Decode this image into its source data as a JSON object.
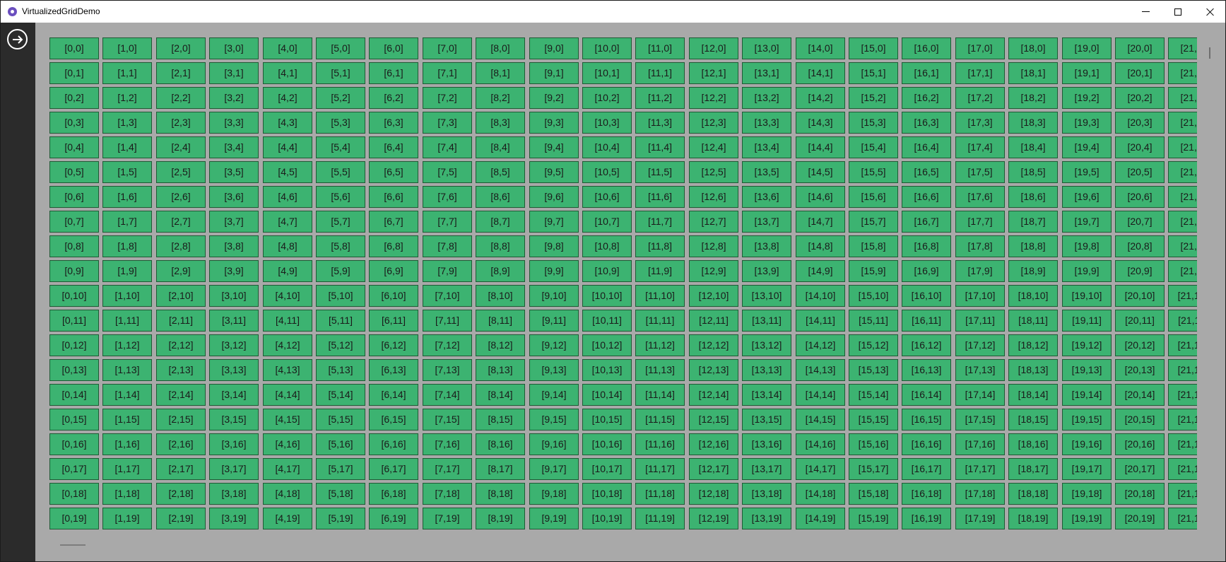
{
  "window": {
    "title": "VirtualizedGridDemo"
  },
  "titlebar": {
    "minimize_label": "Minimize",
    "maximize_label": "Maximize",
    "close_label": "Close"
  },
  "sidebar": {
    "nav_button_icon": "arrow-right-circle-icon"
  },
  "grid": {
    "visible_columns": 22,
    "visible_rows": 20,
    "cell_label_pattern": "[col,row]",
    "cell_color": "#3cb371",
    "background_color": "#a9a9a9"
  },
  "colors": {
    "sidebar": "#2b2b2b",
    "cell_fill": "#3cb371",
    "cell_border": "#1f5a35",
    "content_bg": "#a9a9a9"
  }
}
